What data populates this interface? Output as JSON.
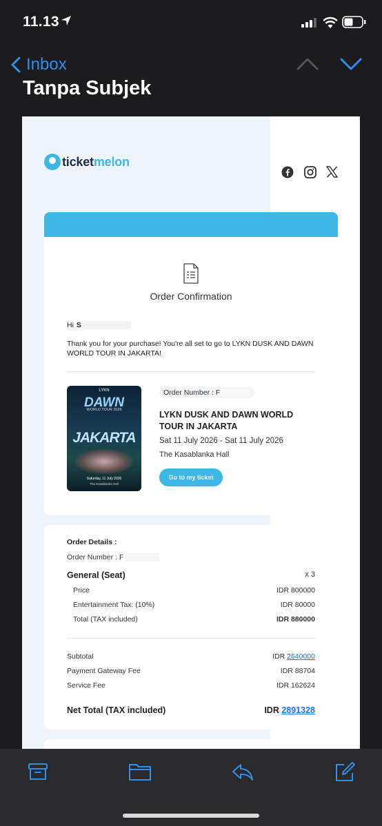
{
  "status": {
    "time": "11.13"
  },
  "nav": {
    "back_label": "Inbox"
  },
  "email": {
    "subject": "Tanpa Subjek",
    "brand": {
      "part1": "ticket",
      "part2": "melon",
      "color": "#3db8e4"
    },
    "social_icons": [
      "facebook-icon",
      "instagram-icon",
      "x-icon"
    ],
    "card_title": "Order Confirmation",
    "greeting_prefix": "Hi",
    "greeting_name": "S",
    "thanks": "Thank you for your purchase! You're all set to go to LYKN DUSK AND DAWN WORLD TOUR IN JAKARTA!",
    "poster": {
      "brand": "LYKN",
      "title": "DAWN",
      "tour": "WORLD TOUR 2026",
      "city": "JAKARTA",
      "date": "Saturday, 11 July 2026",
      "venue": "The Kasablanka Hall"
    },
    "order_number_label": "Order Number : F",
    "event_title": "LYKN DUSK AND DAWN WORLD TOUR IN JAKARTA",
    "event_date": "Sat 11 July 2026 - Sat 11 July 2026",
    "event_venue": "The Kasablanka Hall",
    "ticket_button": "Go to my ticket"
  },
  "order_details": {
    "heading": "Order Details :",
    "order_number_label": "Order Number : F",
    "category": "General (Seat)",
    "quantity": "x 3",
    "price_label": "Price",
    "price_value": "IDR 800000",
    "tax_label": "Entertainment Tax: (10%)",
    "tax_value": "IDR 80000",
    "total_label": "Total (TAX included)",
    "total_value": "IDR 880000",
    "subtotal_label": "Subtotal",
    "subtotal_prefix": "IDR",
    "subtotal_amount": "2640000",
    "gateway_label": "Payment Gateway Fee",
    "gateway_value": "IDR 88704",
    "service_label": "Service Fee",
    "service_value": "IDR 162624",
    "net_label": "Net Total (TAX included)",
    "net_prefix": "IDR",
    "net_amount": "2891328"
  },
  "toolbar": [
    "archive-icon",
    "folder-icon",
    "reply-icon",
    "compose-icon"
  ],
  "colors": {
    "accent": "#2f8ff0",
    "brand": "#3db8e4",
    "background": "#1c1c1e"
  }
}
